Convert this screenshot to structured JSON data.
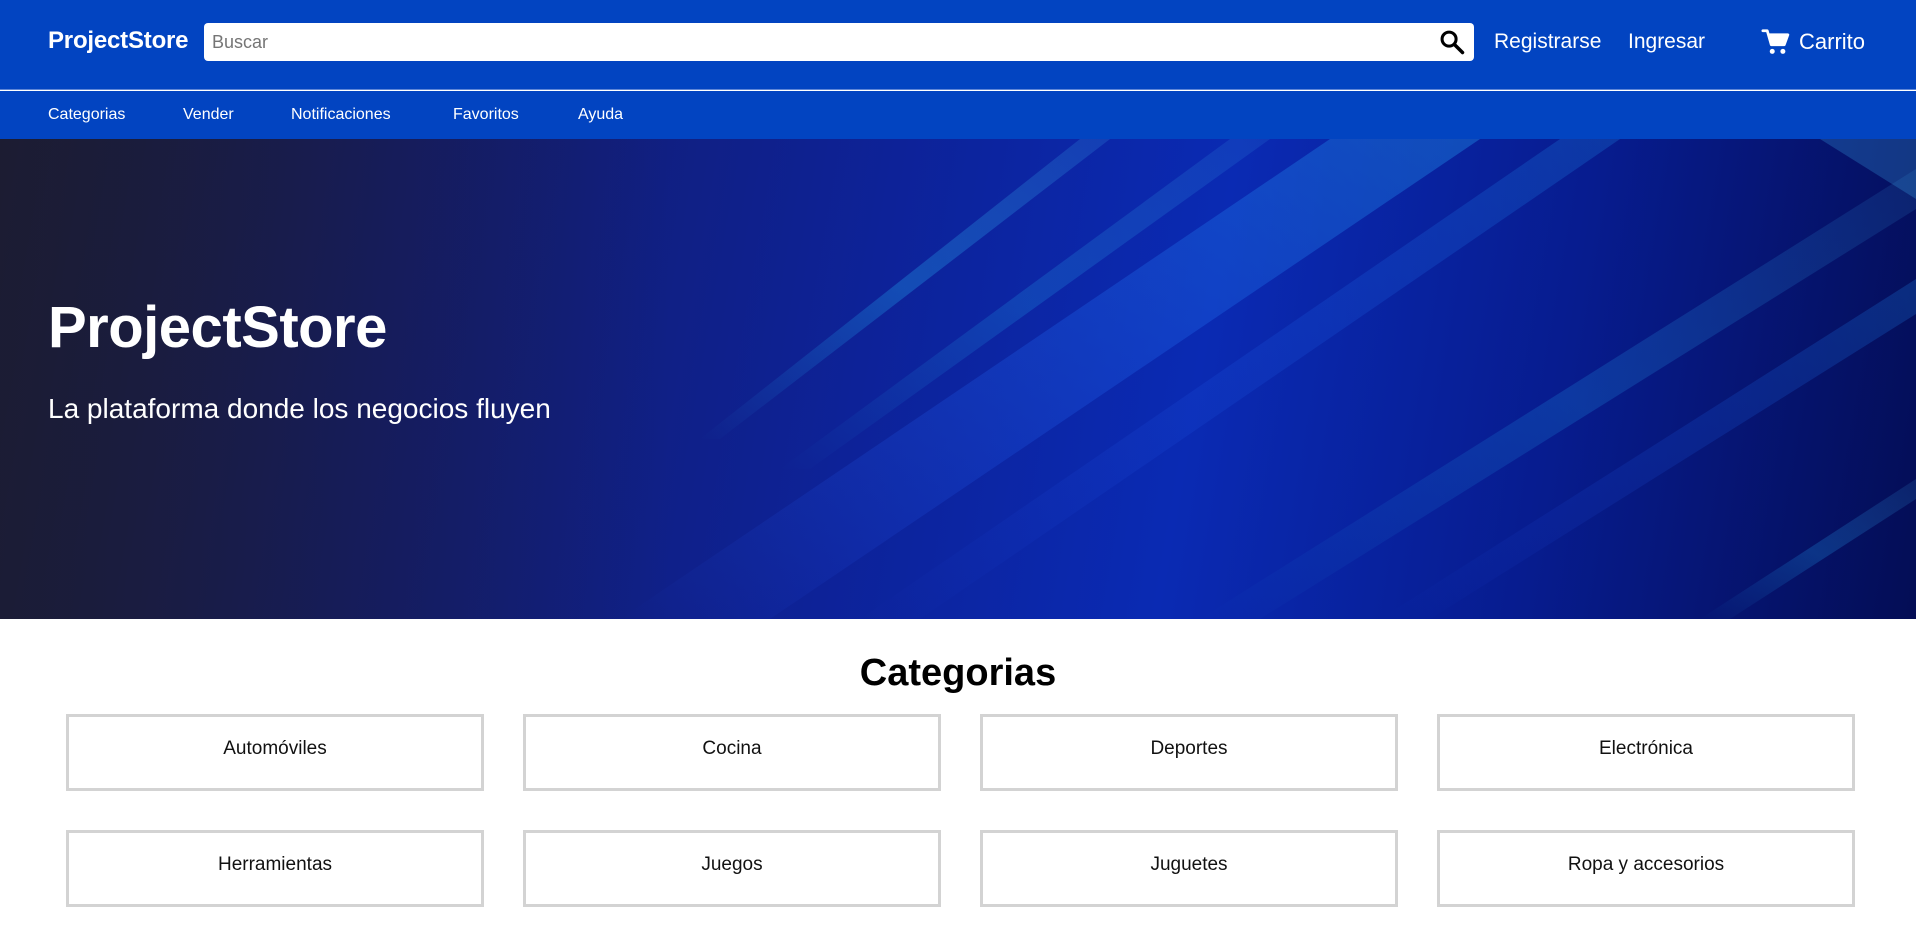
{
  "header": {
    "brand": "ProjectStore",
    "search": {
      "placeholder": "Buscar",
      "value": ""
    },
    "register_label": "Registrarse",
    "login_label": "Ingresar",
    "cart_label": "Carrito",
    "icons": {
      "search": "search-icon",
      "cart": "shopping-cart-icon"
    }
  },
  "nav": {
    "items": [
      {
        "label": "Categorias"
      },
      {
        "label": "Vender"
      },
      {
        "label": "Notificaciones"
      },
      {
        "label": "Favoritos"
      },
      {
        "label": "Ayuda"
      }
    ]
  },
  "hero": {
    "title": "ProjectStore",
    "subtitle": "La plataforma donde los negocios fluyen"
  },
  "categories": {
    "title": "Categorias",
    "items": [
      {
        "label": "Automóviles"
      },
      {
        "label": "Cocina"
      },
      {
        "label": "Deportes"
      },
      {
        "label": "Electrónica"
      },
      {
        "label": "Herramientas"
      },
      {
        "label": "Juegos"
      },
      {
        "label": "Juguetes"
      },
      {
        "label": "Ropa y accesorios"
      }
    ]
  },
  "colors": {
    "primary": "#0244c1",
    "hero_dark": "#141c6a",
    "hero_accent": "#1e8fe0",
    "card_border": "#d3d3d3",
    "text_on_primary": "#ffffff"
  }
}
